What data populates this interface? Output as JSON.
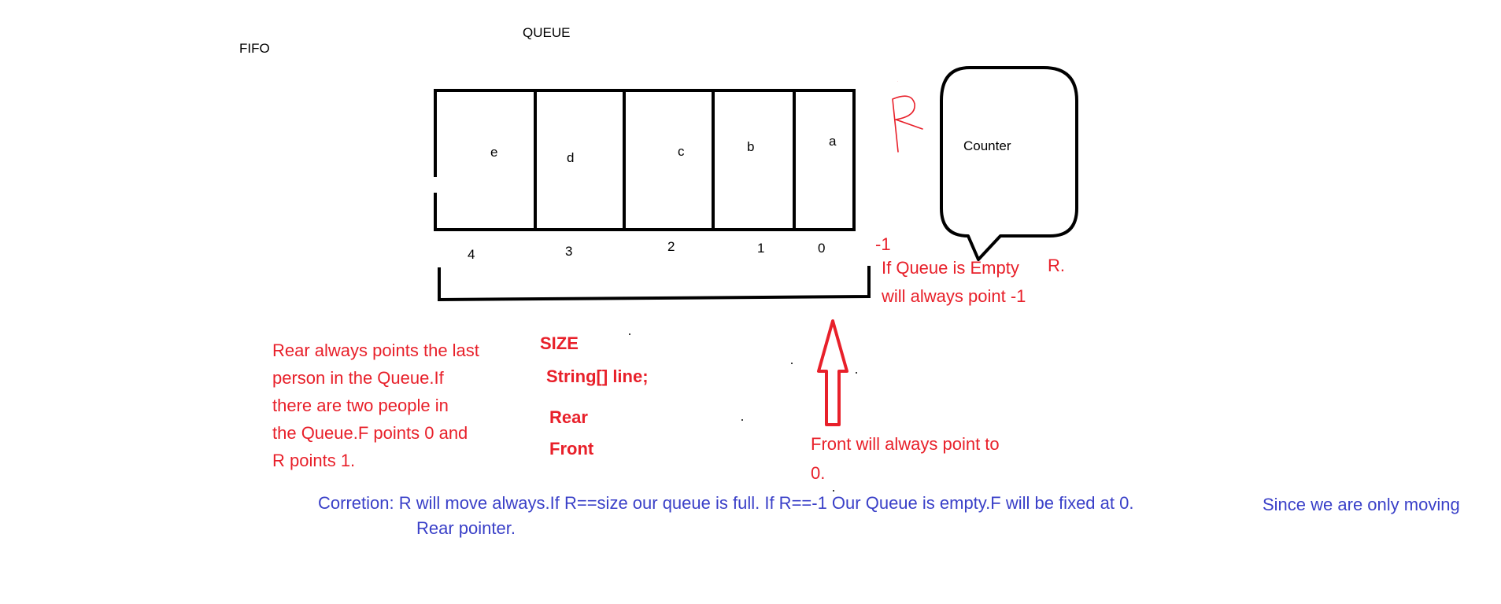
{
  "labels": {
    "fifo": "FIFO",
    "queue_title": "QUEUE",
    "counter": "Counter",
    "minus_one": "-1",
    "r_handwritten": "R"
  },
  "cells": [
    {
      "letter": "e",
      "index": "4"
    },
    {
      "letter": "d",
      "index": "3"
    },
    {
      "letter": "c",
      "index": "2"
    },
    {
      "letter": "b",
      "index": "1"
    },
    {
      "letter": "a",
      "index": "0"
    }
  ],
  "notes": {
    "empty_line1": "If Queue is Empty",
    "empty_r": "R.",
    "empty_line2": "will always point -1",
    "rear_lines": [
      "Rear always points the last",
      "person in the Queue.If",
      "there are two people in",
      "the Queue.F points 0 and",
      "R points 1."
    ],
    "fields": [
      "SIZE",
      "String[] line;",
      "Rear",
      "Front"
    ],
    "front_line1": "Front will always point to",
    "front_line2": "0.",
    "correction_line1a": "Corretion: R will move always.If R==size our queue is full. If R==-1 Our Queue is empty.F will be fixed at 0.",
    "correction_line1b": "Since we are only moving",
    "correction_line2": "Rear pointer."
  },
  "colors": {
    "ink": "#000000",
    "red": "#e8202a",
    "blue": "#3a40c8"
  }
}
